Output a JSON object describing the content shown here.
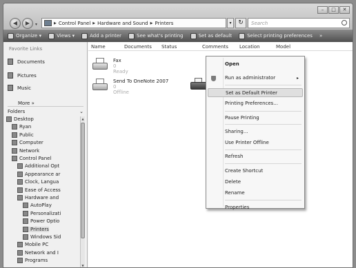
{
  "window": {
    "address": [
      "Control Panel",
      "Hardware and Sound",
      "Printers"
    ],
    "search_placeholder": "Search",
    "caption_buttons": [
      "–",
      "□",
      "✕"
    ]
  },
  "toolbar": {
    "items": [
      "Organize ▾",
      "Views ▾",
      "Add a printer",
      "See what's printing",
      "Set as default",
      "Select printing preferences",
      "»"
    ]
  },
  "sidebar": {
    "favorite_links_title": "Favorite Links",
    "favorites": [
      "Documents",
      "Pictures",
      "Music"
    ],
    "more_label": "More »",
    "folders_label": "Folders",
    "folders_chevron": "⌄",
    "tree": [
      {
        "label": "Desktop",
        "indent": 0,
        "selected": false
      },
      {
        "label": "Ryan",
        "indent": 1,
        "selected": false
      },
      {
        "label": "Public",
        "indent": 1,
        "selected": false
      },
      {
        "label": "Computer",
        "indent": 1,
        "selected": false
      },
      {
        "label": "Network",
        "indent": 1,
        "selected": false
      },
      {
        "label": "Control Panel",
        "indent": 1,
        "selected": false
      },
      {
        "label": "Additional Opt",
        "indent": 2,
        "selected": false
      },
      {
        "label": "Appearance ar",
        "indent": 2,
        "selected": false
      },
      {
        "label": "Clock, Langua",
        "indent": 2,
        "selected": false
      },
      {
        "label": "Ease of Access",
        "indent": 2,
        "selected": false
      },
      {
        "label": "Hardware and",
        "indent": 2,
        "selected": false
      },
      {
        "label": "AutoPlay",
        "indent": 3,
        "selected": false
      },
      {
        "label": "Personalizati",
        "indent": 3,
        "selected": false
      },
      {
        "label": "Power Optio",
        "indent": 3,
        "selected": false
      },
      {
        "label": "Printers",
        "indent": 3,
        "selected": true
      },
      {
        "label": "Windows Sid",
        "indent": 3,
        "selected": false
      },
      {
        "label": "Mobile PC",
        "indent": 2,
        "selected": false
      },
      {
        "label": "Network and I",
        "indent": 2,
        "selected": false
      },
      {
        "label": "Programs",
        "indent": 2,
        "selected": false
      }
    ]
  },
  "list": {
    "columns": [
      "Name",
      "Documents",
      "Status",
      "Comments",
      "Location",
      "Model"
    ],
    "printers": [
      {
        "name": "Fax",
        "docs": "0",
        "status": "Ready"
      },
      {
        "name": "Send To OneNote 2007",
        "docs": "0",
        "status": "Offline"
      }
    ]
  },
  "context_menu": {
    "items": [
      {
        "label": "Open",
        "bold": true,
        "highlighted": false,
        "submenu": false,
        "icon": ""
      },
      {
        "label": "Run as administrator",
        "bold": false,
        "highlighted": false,
        "submenu": true,
        "icon": "shield-icon"
      },
      {
        "label": "Set as Default Printer",
        "bold": false,
        "highlighted": true,
        "submenu": false,
        "icon": ""
      },
      {
        "label": "Printing Preferences...",
        "bold": false,
        "highlighted": false,
        "submenu": false,
        "icon": ""
      },
      {
        "label": "Pause Printing",
        "bold": false,
        "highlighted": false,
        "submenu": false,
        "icon": ""
      },
      {
        "label": "Sharing...",
        "bold": false,
        "highlighted": false,
        "submenu": false,
        "icon": ""
      },
      {
        "label": "Use Printer Offline",
        "bold": false,
        "highlighted": false,
        "submenu": false,
        "icon": ""
      },
      {
        "label": "Refresh",
        "bold": false,
        "highlighted": false,
        "submenu": false,
        "icon": ""
      },
      {
        "label": "Create Shortcut",
        "bold": false,
        "highlighted": false,
        "submenu": false,
        "icon": ""
      },
      {
        "label": "Delete",
        "bold": false,
        "highlighted": false,
        "submenu": false,
        "icon": ""
      },
      {
        "label": "Rename",
        "bold": false,
        "highlighted": false,
        "submenu": false,
        "icon": ""
      },
      {
        "label": "Properties",
        "bold": false,
        "highlighted": false,
        "submenu": false,
        "icon": ""
      }
    ],
    "submenu_arrow": "▸"
  }
}
